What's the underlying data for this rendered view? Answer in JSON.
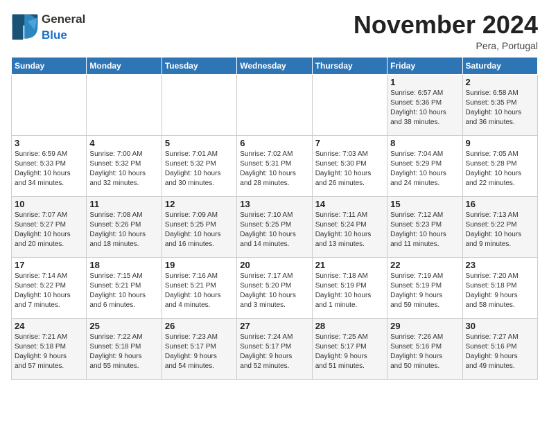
{
  "logo": {
    "general": "General",
    "blue": "Blue"
  },
  "header": {
    "month": "November 2024",
    "location": "Pera, Portugal"
  },
  "weekdays": [
    "Sunday",
    "Monday",
    "Tuesday",
    "Wednesday",
    "Thursday",
    "Friday",
    "Saturday"
  ],
  "weeks": [
    [
      {
        "day": "",
        "info": ""
      },
      {
        "day": "",
        "info": ""
      },
      {
        "day": "",
        "info": ""
      },
      {
        "day": "",
        "info": ""
      },
      {
        "day": "",
        "info": ""
      },
      {
        "day": "1",
        "info": "Sunrise: 6:57 AM\nSunset: 5:36 PM\nDaylight: 10 hours\nand 38 minutes."
      },
      {
        "day": "2",
        "info": "Sunrise: 6:58 AM\nSunset: 5:35 PM\nDaylight: 10 hours\nand 36 minutes."
      }
    ],
    [
      {
        "day": "3",
        "info": "Sunrise: 6:59 AM\nSunset: 5:33 PM\nDaylight: 10 hours\nand 34 minutes."
      },
      {
        "day": "4",
        "info": "Sunrise: 7:00 AM\nSunset: 5:32 PM\nDaylight: 10 hours\nand 32 minutes."
      },
      {
        "day": "5",
        "info": "Sunrise: 7:01 AM\nSunset: 5:32 PM\nDaylight: 10 hours\nand 30 minutes."
      },
      {
        "day": "6",
        "info": "Sunrise: 7:02 AM\nSunset: 5:31 PM\nDaylight: 10 hours\nand 28 minutes."
      },
      {
        "day": "7",
        "info": "Sunrise: 7:03 AM\nSunset: 5:30 PM\nDaylight: 10 hours\nand 26 minutes."
      },
      {
        "day": "8",
        "info": "Sunrise: 7:04 AM\nSunset: 5:29 PM\nDaylight: 10 hours\nand 24 minutes."
      },
      {
        "day": "9",
        "info": "Sunrise: 7:05 AM\nSunset: 5:28 PM\nDaylight: 10 hours\nand 22 minutes."
      }
    ],
    [
      {
        "day": "10",
        "info": "Sunrise: 7:07 AM\nSunset: 5:27 PM\nDaylight: 10 hours\nand 20 minutes."
      },
      {
        "day": "11",
        "info": "Sunrise: 7:08 AM\nSunset: 5:26 PM\nDaylight: 10 hours\nand 18 minutes."
      },
      {
        "day": "12",
        "info": "Sunrise: 7:09 AM\nSunset: 5:25 PM\nDaylight: 10 hours\nand 16 minutes."
      },
      {
        "day": "13",
        "info": "Sunrise: 7:10 AM\nSunset: 5:25 PM\nDaylight: 10 hours\nand 14 minutes."
      },
      {
        "day": "14",
        "info": "Sunrise: 7:11 AM\nSunset: 5:24 PM\nDaylight: 10 hours\nand 13 minutes."
      },
      {
        "day": "15",
        "info": "Sunrise: 7:12 AM\nSunset: 5:23 PM\nDaylight: 10 hours\nand 11 minutes."
      },
      {
        "day": "16",
        "info": "Sunrise: 7:13 AM\nSunset: 5:22 PM\nDaylight: 10 hours\nand 9 minutes."
      }
    ],
    [
      {
        "day": "17",
        "info": "Sunrise: 7:14 AM\nSunset: 5:22 PM\nDaylight: 10 hours\nand 7 minutes."
      },
      {
        "day": "18",
        "info": "Sunrise: 7:15 AM\nSunset: 5:21 PM\nDaylight: 10 hours\nand 6 minutes."
      },
      {
        "day": "19",
        "info": "Sunrise: 7:16 AM\nSunset: 5:21 PM\nDaylight: 10 hours\nand 4 minutes."
      },
      {
        "day": "20",
        "info": "Sunrise: 7:17 AM\nSunset: 5:20 PM\nDaylight: 10 hours\nand 3 minutes."
      },
      {
        "day": "21",
        "info": "Sunrise: 7:18 AM\nSunset: 5:19 PM\nDaylight: 10 hours\nand 1 minute."
      },
      {
        "day": "22",
        "info": "Sunrise: 7:19 AM\nSunset: 5:19 PM\nDaylight: 9 hours\nand 59 minutes."
      },
      {
        "day": "23",
        "info": "Sunrise: 7:20 AM\nSunset: 5:18 PM\nDaylight: 9 hours\nand 58 minutes."
      }
    ],
    [
      {
        "day": "24",
        "info": "Sunrise: 7:21 AM\nSunset: 5:18 PM\nDaylight: 9 hours\nand 57 minutes."
      },
      {
        "day": "25",
        "info": "Sunrise: 7:22 AM\nSunset: 5:18 PM\nDaylight: 9 hours\nand 55 minutes."
      },
      {
        "day": "26",
        "info": "Sunrise: 7:23 AM\nSunset: 5:17 PM\nDaylight: 9 hours\nand 54 minutes."
      },
      {
        "day": "27",
        "info": "Sunrise: 7:24 AM\nSunset: 5:17 PM\nDaylight: 9 hours\nand 52 minutes."
      },
      {
        "day": "28",
        "info": "Sunrise: 7:25 AM\nSunset: 5:17 PM\nDaylight: 9 hours\nand 51 minutes."
      },
      {
        "day": "29",
        "info": "Sunrise: 7:26 AM\nSunset: 5:16 PM\nDaylight: 9 hours\nand 50 minutes."
      },
      {
        "day": "30",
        "info": "Sunrise: 7:27 AM\nSunset: 5:16 PM\nDaylight: 9 hours\nand 49 minutes."
      }
    ]
  ]
}
